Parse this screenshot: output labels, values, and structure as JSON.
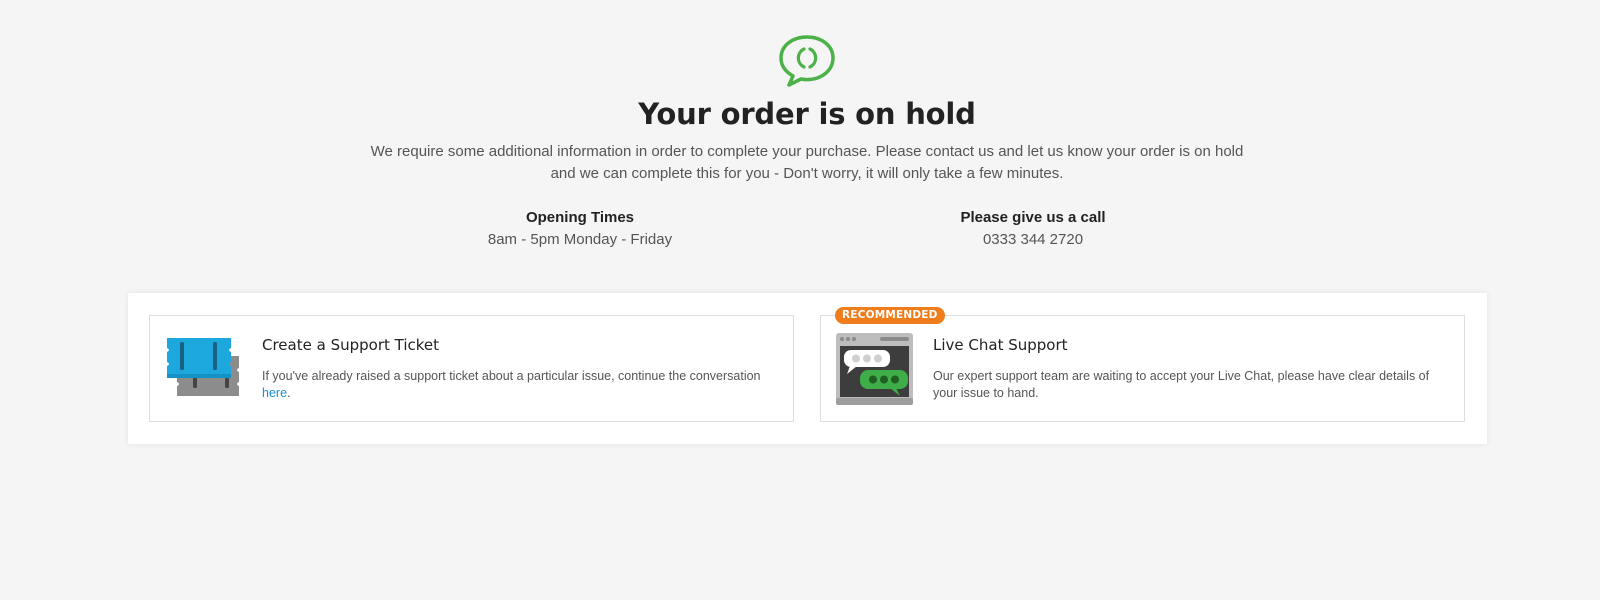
{
  "hero": {
    "icon": "chat-bubble-icon",
    "accent_color": "#4cb148",
    "title": "Your order is on hold",
    "description": "We require some additional information in order to complete your purchase. Please contact us and let us know your order is on hold and we can complete this for you - Don't worry, it will only take a few minutes."
  },
  "contact_info": {
    "opening_times_heading": "Opening Times",
    "opening_times_value": "8am - 5pm Monday - Friday",
    "call_heading": "Please give us a call",
    "phone_number": "0333 344 2720"
  },
  "support_options": [
    {
      "icon": "support-ticket-icon",
      "title": "Create a Support Ticket",
      "description": "If you've already raised a support ticket about a particular issue, continue the conversation",
      "link_text": "here",
      "link_suffix": "."
    },
    {
      "icon": "live-chat-icon",
      "badge": "RECOMMENDED",
      "badge_color": "#f07d1c",
      "title": "Live Chat Support",
      "description": "Our expert support team are waiting to accept your Live Chat, please have clear details of your issue to hand."
    }
  ]
}
